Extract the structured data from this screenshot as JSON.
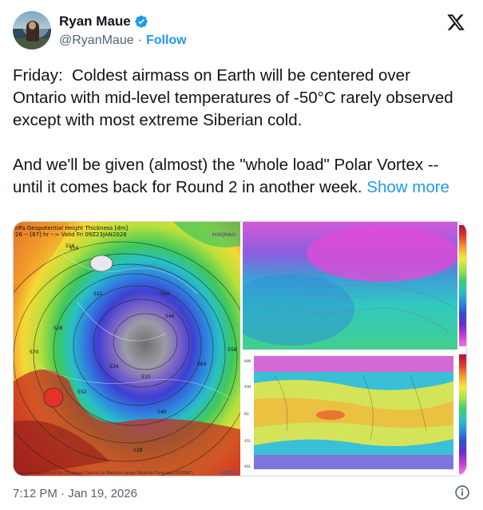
{
  "author": {
    "display_name": "Ryan Maue",
    "handle": "@RyanMaue",
    "separator": "·",
    "follow_label": "Follow"
  },
  "tweet": {
    "text": "Friday:  Coldest airmass on Earth will be centered over Ontario with mid-level temperatures of -50°C rarely observed except with most extreme Siberian cold.\n\nAnd we'll be given (almost) the \"whole load\" Polar Vortex -- until it comes back for Round 2 in another week. ",
    "show_more_label": "Show more"
  },
  "media": {
    "left_map_title": "nPa Geopotential Height Thickness [dm]\n26 -- [87] hr --> Valid Fri 09Z23JAN2026",
    "left_map_tag": "MIN|MAX:",
    "left_map_footer": "ata and products of the European Centre for Medium-range Weather Forecasts (ECMWF)",
    "left_map_logo": "weatf",
    "contour_labels": [
      "516",
      "522",
      "504",
      "510",
      "534",
      "558",
      "528",
      "564",
      "570",
      "552",
      "540",
      "546",
      "516",
      "528"
    ]
  },
  "footer": {
    "timestamp": "7:12 PM · Jan 19, 2026"
  },
  "colors": {
    "accent": "#1d9bf0",
    "text": "#0f1419",
    "secondary": "#536471"
  },
  "icons": {
    "verified": "verified-badge-icon",
    "logo": "x-logo-icon",
    "info": "info-icon"
  }
}
